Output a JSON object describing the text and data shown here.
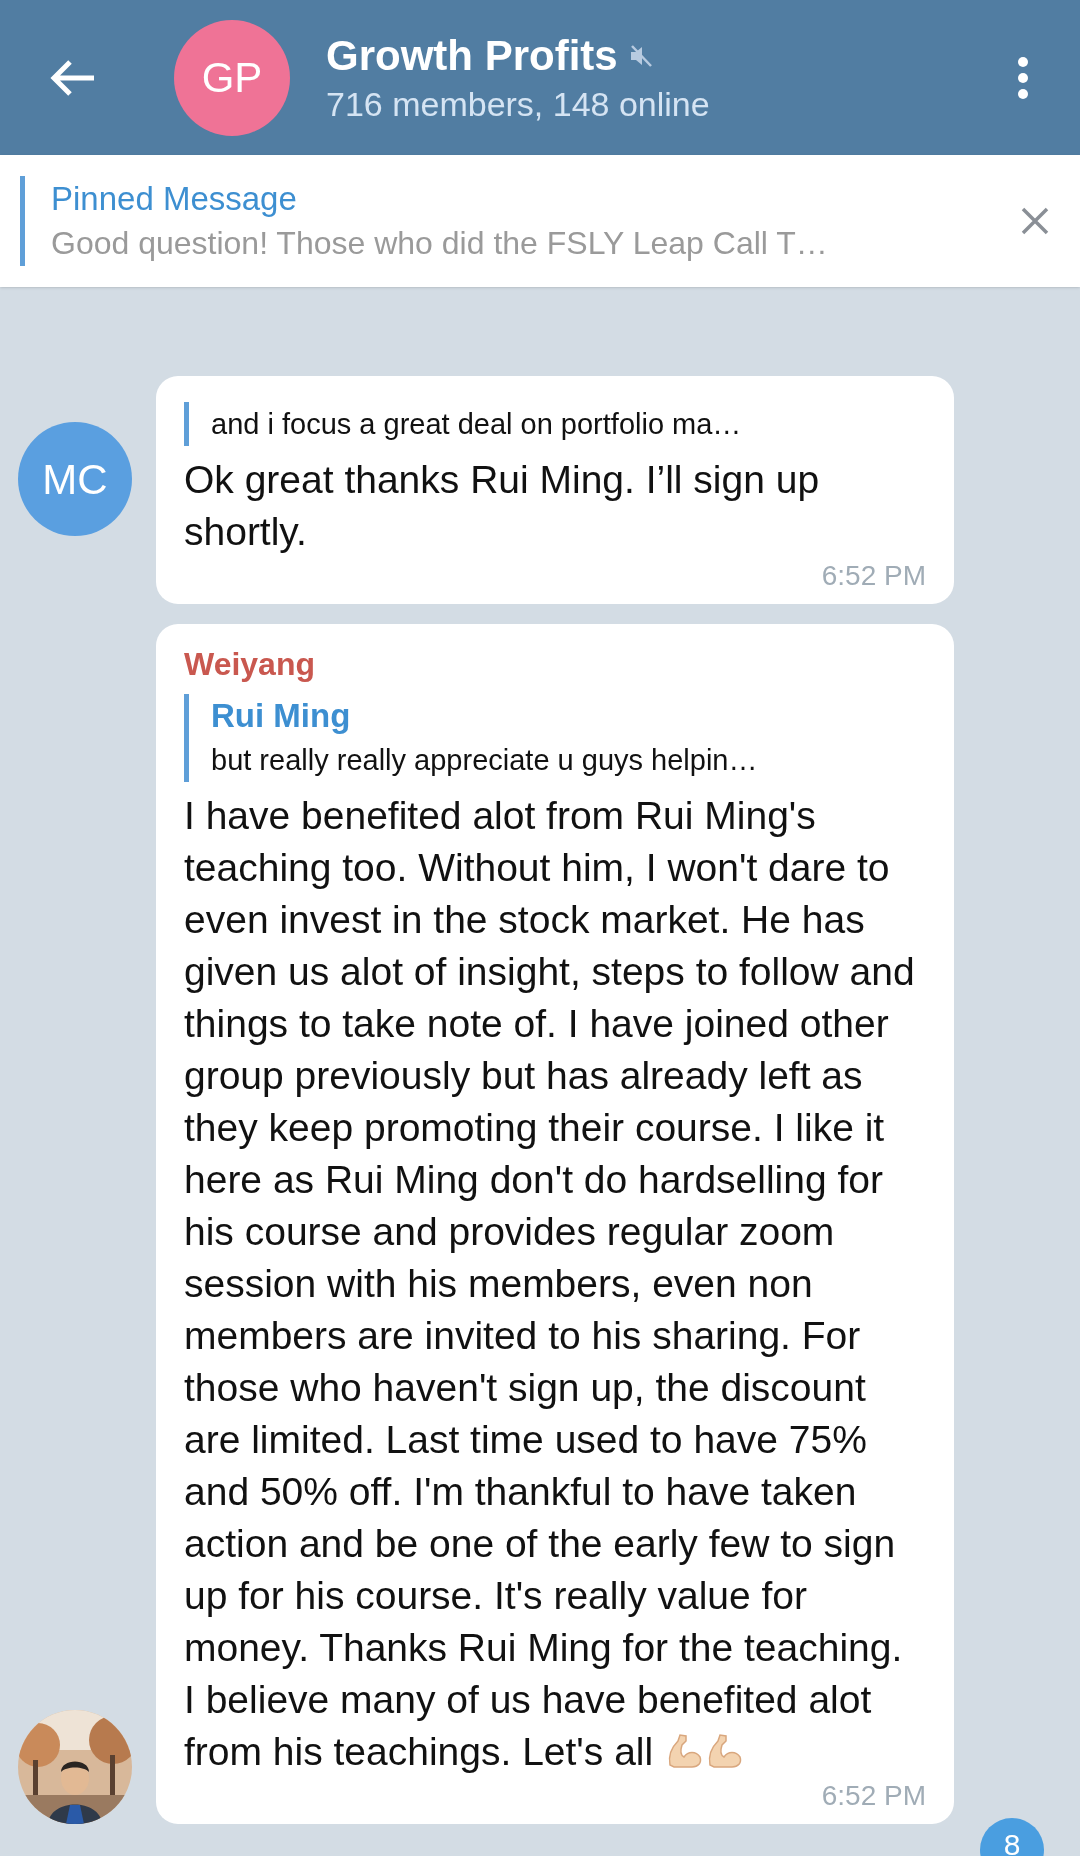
{
  "header": {
    "avatar_initials": "GP",
    "title": "Growth Profits",
    "muted": true,
    "subtitle": "716 members, 148 online"
  },
  "pinned": {
    "label": "Pinned Message",
    "text": "Good question! Those who did the FSLY Leap Call T…"
  },
  "messages": [
    {
      "avatar": {
        "kind": "initials",
        "initials": "MC"
      },
      "reply_text": "and i focus a great deal on portfolio ma…",
      "text": "Ok great thanks Rui Ming. I’ll sign up shortly.",
      "time": "6:52 PM"
    },
    {
      "sender": "Weiyang",
      "color": "#c9584f",
      "reply_name": "Rui Ming",
      "reply_text": "but really really appreciate u guys helpin…",
      "text": "I have benefited alot from Rui Ming's teaching too. Without him, I won't dare to even invest in the stock market. He has given us alot of insight, steps to follow and things to take note of. I have joined other group previously but has already left as they keep promoting their course. I like it here as Rui Ming don't do hardselling for his course and provides regular zoom session with his members, even non members are invited to his sharing. For those who haven't sign up, the discount are limited. Last time used to have 75% and 50% off. I'm thankful to have taken action and be one of the early few to sign up for his course. It's really value for money. Thanks Rui Ming for the teaching. I believe many of us have benefited alot from his teachings. Let's all",
      "trailing_icons": [
        {
          "kind": "flexed-arm"
        },
        {
          "kind": "flexed-arm"
        }
      ],
      "time": "6:52 PM"
    }
  ],
  "unread_badge": "8"
}
